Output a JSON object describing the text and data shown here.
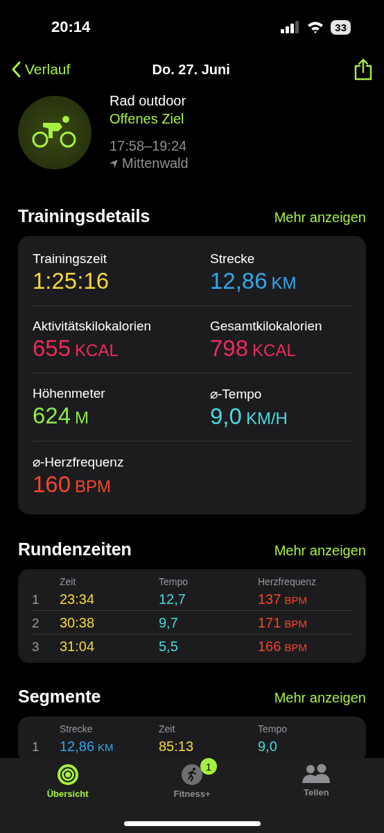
{
  "status_bar": {
    "time": "20:14",
    "battery": "33"
  },
  "nav": {
    "back": "Verlauf",
    "title": "Do. 27. Juni"
  },
  "workout": {
    "name": "Rad outdoor",
    "goal": "Offenes Ziel",
    "time_range": "17:58–19:24",
    "location": "Mittenwald"
  },
  "details": {
    "title": "Trainingsdetails",
    "more": "Mehr anzeigen",
    "metrics": [
      {
        "label": "Trainingszeit",
        "value": "1:25:16",
        "color": "#f5d63d"
      },
      {
        "label": "Strecke",
        "value": "12,86",
        "unit": "KM",
        "color": "#2fa8f0"
      },
      {
        "label": "Aktivitätskilokalorien",
        "value": "655",
        "unit": "KCAL",
        "color": "#ee2b5b"
      },
      {
        "label": "Gesamtkilokalorien",
        "value": "798",
        "unit": "KCAL",
        "color": "#ee2b5b"
      },
      {
        "label": "Höhenmeter",
        "value": "624",
        "unit": "M",
        "color": "#8ee94a"
      },
      {
        "label": "⌀-Tempo",
        "value": "9,0",
        "unit": "KM/H",
        "color": "#47d9e0"
      },
      {
        "label": "⌀-Herzfrequenz",
        "value": "160",
        "unit": "BPM",
        "color": "#f5462e"
      }
    ]
  },
  "laps": {
    "title": "Rundenzeiten",
    "more": "Mehr anzeigen",
    "columns": [
      "Zeit",
      "Tempo",
      "Herzfrequenz"
    ],
    "rows": [
      {
        "index": "1",
        "time": "23:34",
        "tempo": "12,7",
        "heart_rate": "137",
        "unit": "BPM"
      },
      {
        "index": "2",
        "time": "30:38",
        "tempo": "9,7",
        "heart_rate": "171",
        "unit": "BPM"
      },
      {
        "index": "3",
        "time": "31:04",
        "tempo": "5,5",
        "heart_rate": "166",
        "unit": "BPM"
      }
    ]
  },
  "segments": {
    "title": "Segmente",
    "more": "Mehr anzeigen",
    "columns": [
      "Strecke",
      "Zeit",
      "Tempo"
    ],
    "rows": [
      {
        "index": "1",
        "distance": "12,86",
        "unit": "KM",
        "time": "85:13",
        "tempo": "9,0"
      }
    ]
  },
  "tab_bar": {
    "items": [
      {
        "kind": "activity",
        "label": "Übersicht",
        "selected": true
      },
      {
        "kind": "fitness",
        "label": "Fitness+",
        "selected": false,
        "badge": "1"
      },
      {
        "kind": "sharing",
        "label": "Teilen",
        "selected": false
      }
    ]
  }
}
